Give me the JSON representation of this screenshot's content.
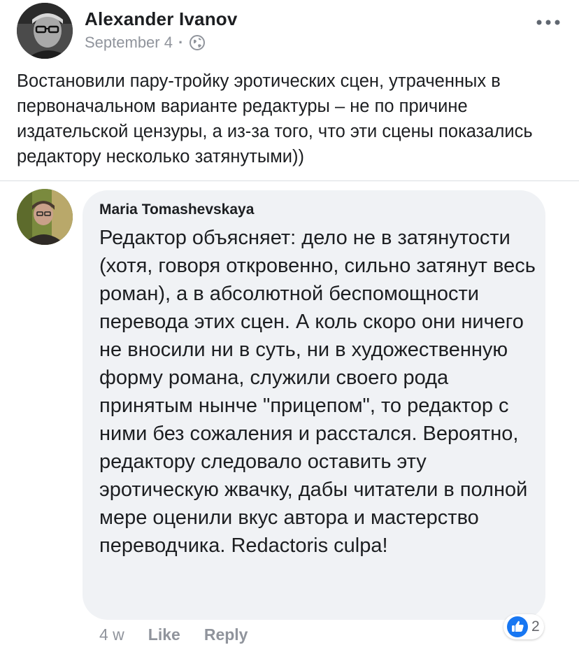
{
  "post": {
    "author": "Alexander Ivanov",
    "date": "September 4",
    "separator": "·",
    "privacy_icon": "globe-icon",
    "more_icon": "more-options-icon",
    "text": "Востановили пару-тройку эротических сцен, утраченных в первоначальном варианте редактуры – не по причине издательской цензуры, а из-за того, что эти сцены показались редактору несколько затянутыми))"
  },
  "comment": {
    "author": "Maria Tomashevskaya",
    "text": "Редактор объясняет: дело не в затянутости (хотя, говоря откровенно, сильно затянут весь роман), а в абсолютной беспомощности перевода этих сцен. А коль скоро они ничего не вносили ни в суть, ни в художественную форму романа, служили своего рода принятым нынче \"прицепом\", то редактор с ними без сожаления и расстался. Вероятно, редактору следовало оставить эту эротическую жвачку, дабы  читатели в полной мере оценили вкус автора и мастерство переводчика. Redactoris culpa!",
    "timestamp": "4 w",
    "like_label": "Like",
    "reply_label": "Reply",
    "reaction_icon": "like-icon",
    "reaction_count": "2"
  },
  "colors": {
    "bubble": "#f0f2f5",
    "meta_text": "#90949c",
    "like_blue": "#1877f2"
  }
}
